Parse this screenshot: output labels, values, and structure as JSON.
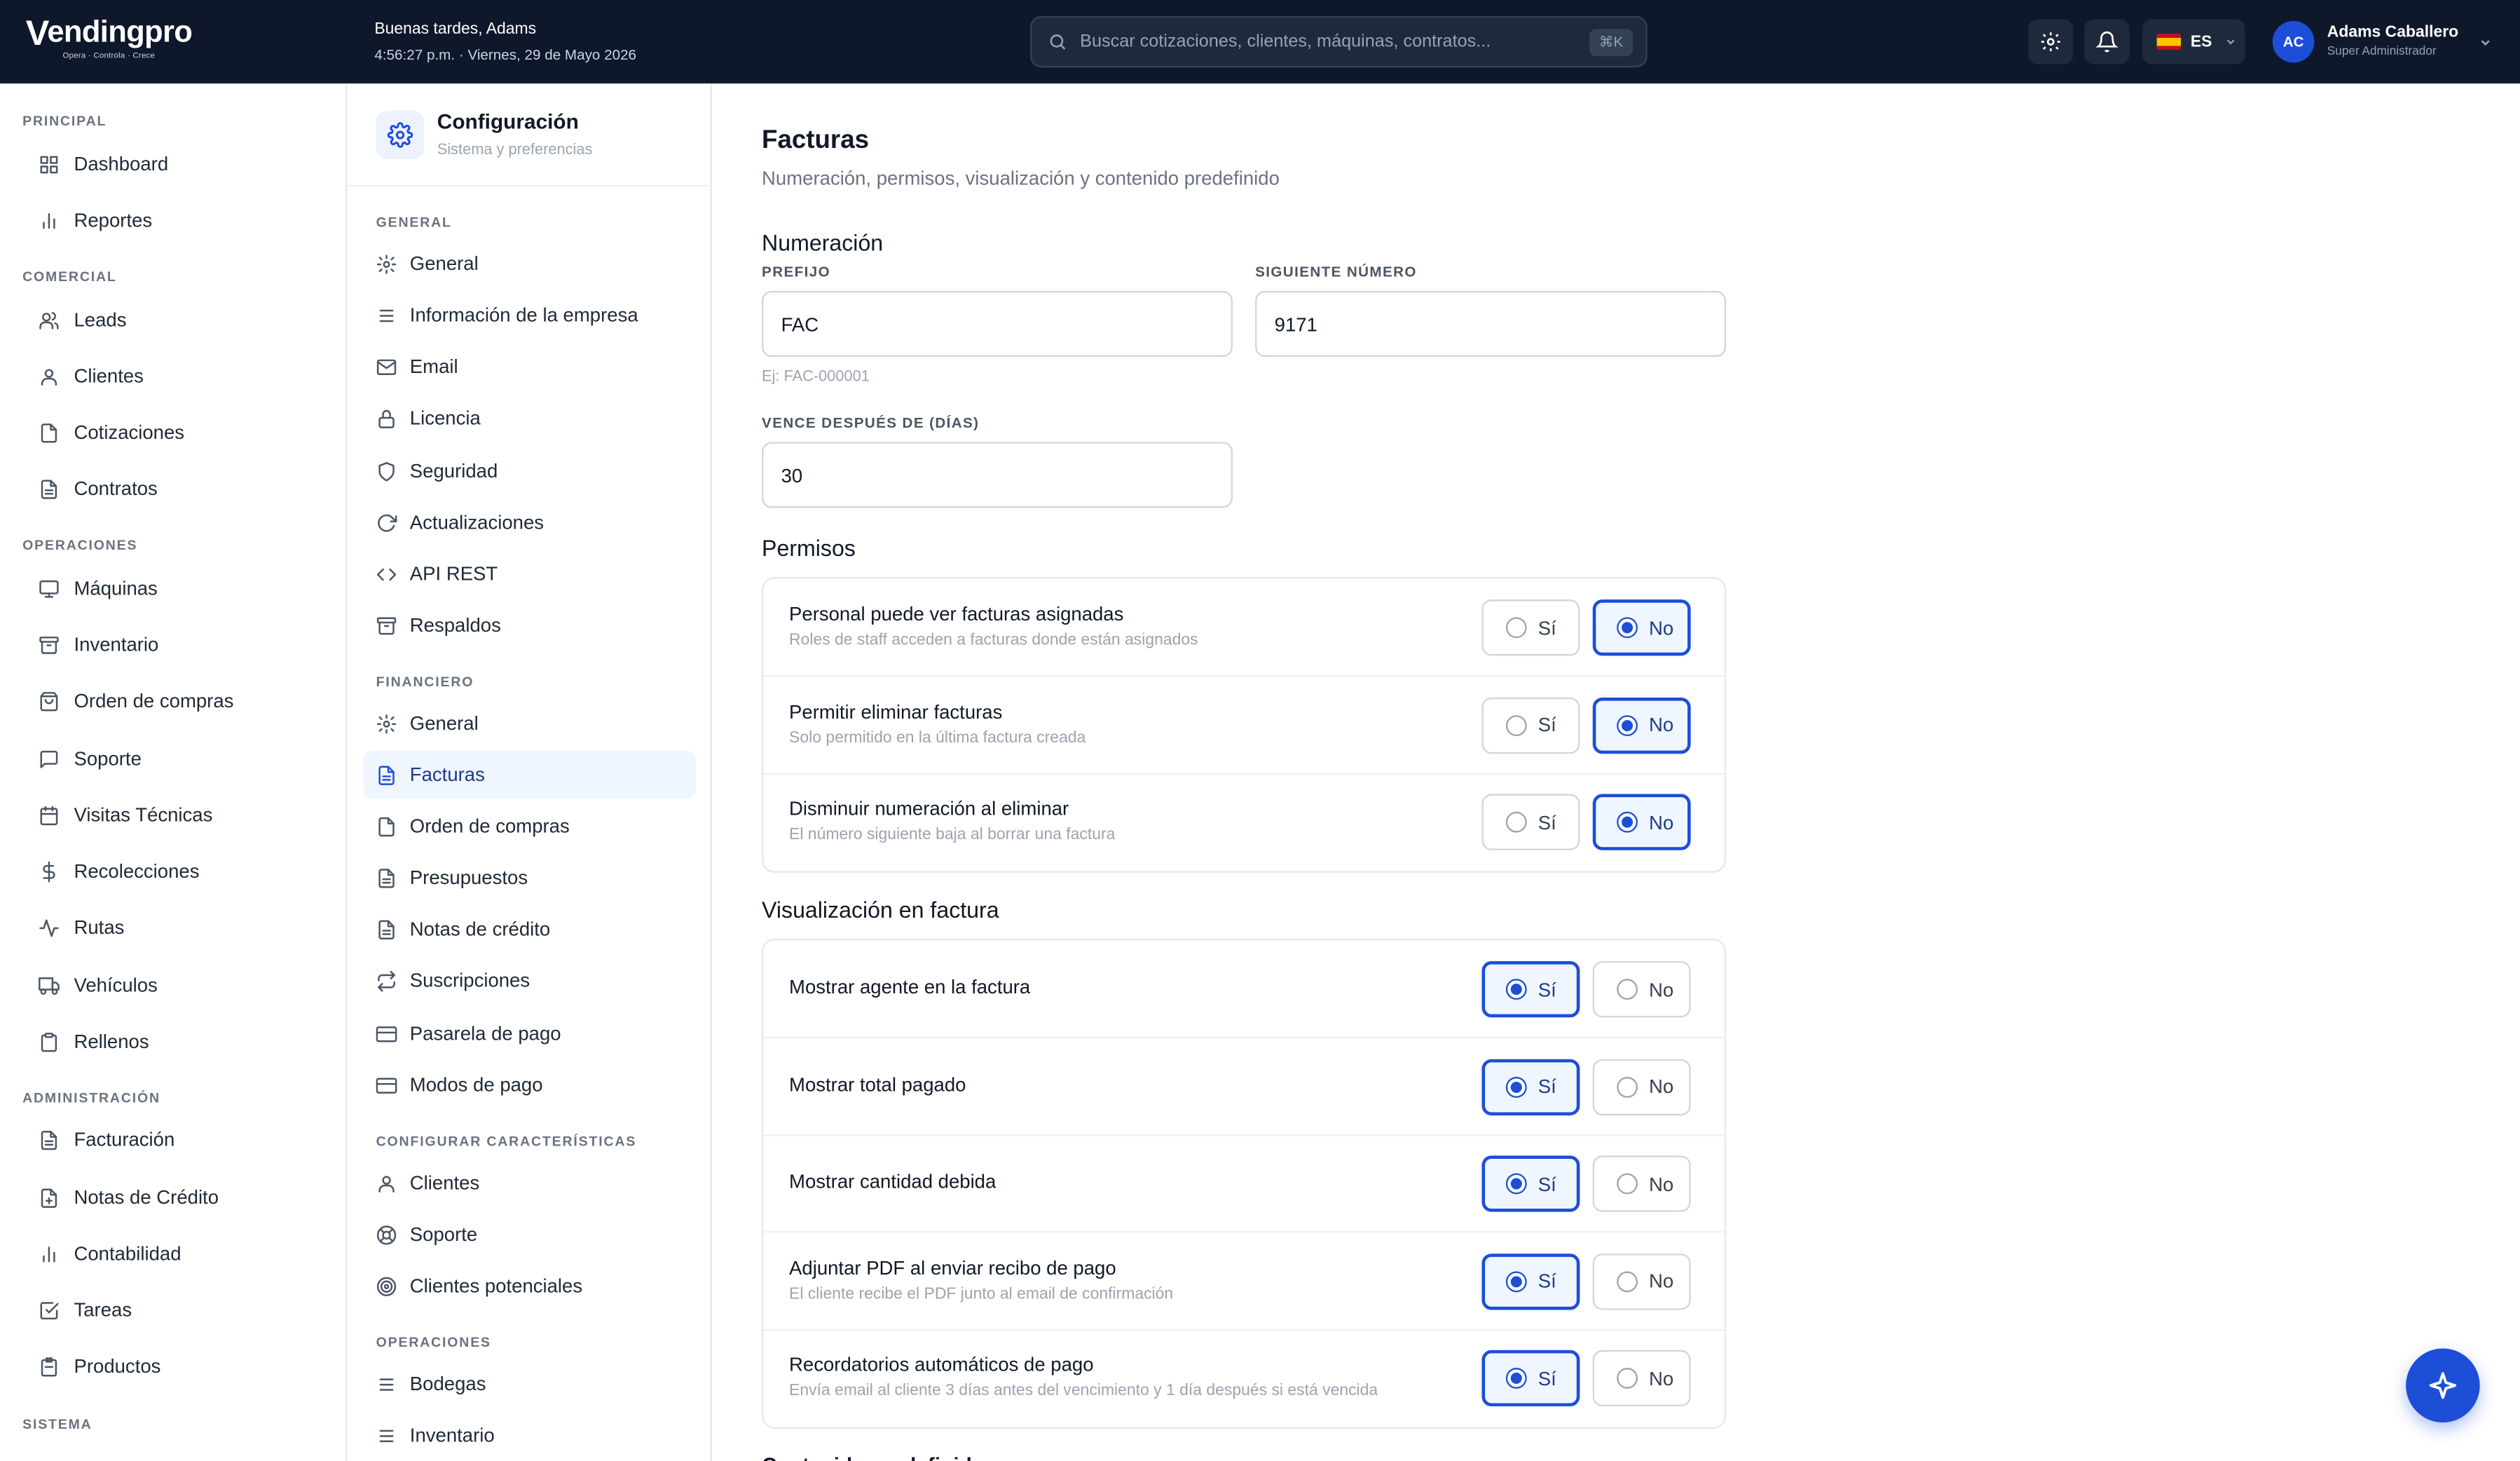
{
  "brand": {
    "name": "endingpro",
    "tagline": "Opera · Controla · Crece"
  },
  "header": {
    "greeting": "Buenas tardes, Adams",
    "datetime": "4:56:27 p.m. · Viernes, 29 de Mayo 2026",
    "search_placeholder": "Buscar cotizaciones, clientes, máquinas, contratos...",
    "search_shortcut": "⌘K",
    "language": "ES",
    "user_initials": "AC",
    "user_name": "Adams Caballero",
    "user_role": "Super Administrador"
  },
  "sidebar": {
    "sections": [
      {
        "title": "PRINCIPAL",
        "items": [
          {
            "label": "Dashboard",
            "icon": "grid-icon"
          },
          {
            "label": "Reportes",
            "icon": "bar-chart-icon"
          }
        ]
      },
      {
        "title": "COMERCIAL",
        "items": [
          {
            "label": "Leads",
            "icon": "users-icon"
          },
          {
            "label": "Clientes",
            "icon": "user-icon"
          },
          {
            "label": "Cotizaciones",
            "icon": "file-icon"
          },
          {
            "label": "Contratos",
            "icon": "file-text-icon"
          }
        ]
      },
      {
        "title": "OPERACIONES",
        "items": [
          {
            "label": "Máquinas",
            "icon": "monitor-icon"
          },
          {
            "label": "Inventario",
            "icon": "archive-icon"
          },
          {
            "label": "Orden de compras",
            "icon": "shopping-bag-icon"
          },
          {
            "label": "Soporte",
            "icon": "message-icon"
          },
          {
            "label": "Visitas Técnicas",
            "icon": "calendar-icon"
          },
          {
            "label": "Recolecciones",
            "icon": "dollar-icon"
          },
          {
            "label": "Rutas",
            "icon": "activity-icon"
          },
          {
            "label": "Vehículos",
            "icon": "truck-icon"
          },
          {
            "label": "Rellenos",
            "icon": "clipboard-icon"
          }
        ]
      },
      {
        "title": "ADMINISTRACIÓN",
        "items": [
          {
            "label": "Facturación",
            "icon": "file-text-icon"
          },
          {
            "label": "Notas de Crédito",
            "icon": "file-plus-icon"
          },
          {
            "label": "Contabilidad",
            "icon": "bar-chart-icon"
          },
          {
            "label": "Tareas",
            "icon": "check-square-icon"
          },
          {
            "label": "Productos",
            "icon": "package-icon"
          }
        ]
      },
      {
        "title": "SISTEMA",
        "items": []
      }
    ]
  },
  "config": {
    "title": "Configuración",
    "subtitle": "Sistema y preferencias",
    "sections": [
      {
        "title": "GENERAL",
        "items": [
          {
            "label": "General",
            "icon": "gear-icon"
          },
          {
            "label": "Información de la empresa",
            "icon": "menu-icon"
          },
          {
            "label": "Email",
            "icon": "mail-icon"
          },
          {
            "label": "Licencia",
            "icon": "lock-icon"
          },
          {
            "label": "Seguridad",
            "icon": "shield-icon"
          },
          {
            "label": "Actualizaciones",
            "icon": "refresh-icon"
          },
          {
            "label": "API REST",
            "icon": "code-icon"
          },
          {
            "label": "Respaldos",
            "icon": "archive-icon"
          }
        ]
      },
      {
        "title": "FINANCIERO",
        "items": [
          {
            "label": "General",
            "icon": "gear-icon"
          },
          {
            "label": "Facturas",
            "icon": "file-text-icon",
            "active": true
          },
          {
            "label": "Orden de compras",
            "icon": "file-icon"
          },
          {
            "label": "Presupuestos",
            "icon": "file-text-icon"
          },
          {
            "label": "Notas de crédito",
            "icon": "file-text-icon"
          },
          {
            "label": "Suscripciones",
            "icon": "repeat-icon"
          },
          {
            "label": "Pasarela de pago",
            "icon": "credit-card-icon"
          },
          {
            "label": "Modos de pago",
            "icon": "credit-card-icon"
          }
        ]
      },
      {
        "title": "CONFIGURAR CARACTERÍSTICAS",
        "items": [
          {
            "label": "Clientes",
            "icon": "user-icon"
          },
          {
            "label": "Soporte",
            "icon": "life-buoy-icon"
          },
          {
            "label": "Clientes potenciales",
            "icon": "target-icon"
          }
        ]
      },
      {
        "title": "OPERACIONES",
        "items": [
          {
            "label": "Bodegas",
            "icon": "menu-icon"
          },
          {
            "label": "Inventario",
            "icon": "menu-icon"
          }
        ]
      }
    ]
  },
  "main": {
    "title": "Facturas",
    "subtitle": "Numeración, permisos, visualización y contenido predefinido",
    "numbering": {
      "heading": "Numeración",
      "prefix_label": "PREFIJO",
      "prefix_value": "FAC",
      "prefix_hint": "Ej: FAC-000001",
      "next_label": "SIGUIENTE NÚMERO",
      "next_value": "9171",
      "due_label": "VENCE DESPUÉS DE (DÍAS)",
      "due_value": "30"
    },
    "yes_label": "Sí",
    "no_label": "No",
    "permissions": {
      "heading": "Permisos",
      "rows": [
        {
          "title": "Personal puede ver facturas asignadas",
          "desc": "Roles de staff acceden a facturas donde están asignados",
          "selected": "no"
        },
        {
          "title": "Permitir eliminar facturas",
          "desc": "Solo permitido en la última factura creada",
          "selected": "no"
        },
        {
          "title": "Disminuir numeración al eliminar",
          "desc": "El número siguiente baja al borrar una factura",
          "selected": "no"
        }
      ]
    },
    "display": {
      "heading": "Visualización en factura",
      "rows": [
        {
          "title": "Mostrar agente en la factura",
          "desc": "",
          "selected": "si"
        },
        {
          "title": "Mostrar total pagado",
          "desc": "",
          "selected": "si"
        },
        {
          "title": "Mostrar cantidad debida",
          "desc": "",
          "selected": "si"
        },
        {
          "title": "Adjuntar PDF al enviar recibo de pago",
          "desc": "El cliente recibe el PDF junto al email de confirmación",
          "selected": "si"
        },
        {
          "title": "Recordatorios automáticos de pago",
          "desc": "Envía email al cliente 3 días antes del vencimiento y 1 día después si está vencida",
          "selected": "si"
        }
      ]
    },
    "next_heading": "Contenido predefinido"
  },
  "colors": {
    "accent": "#1d4ed8",
    "topbar": "#0f172a"
  }
}
